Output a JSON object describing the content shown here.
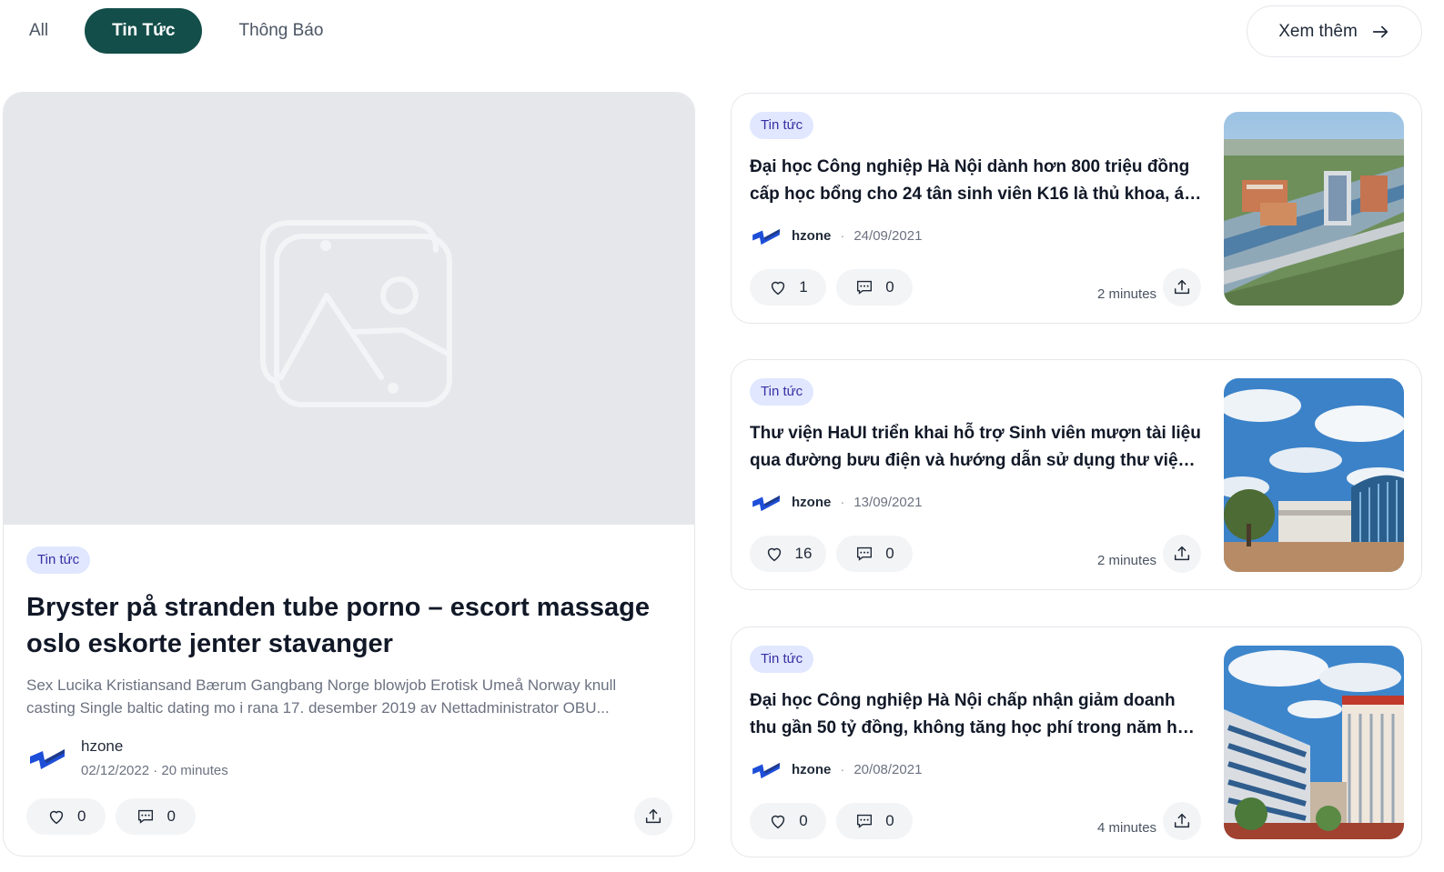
{
  "tabs": [
    {
      "label": "All"
    },
    {
      "label": "Tin Tức"
    },
    {
      "label": "Thông Báo"
    }
  ],
  "more_button": {
    "label": "Xem thêm"
  },
  "featured": {
    "badge": "Tin tức",
    "title": "Bryster på stranden tube porno – escort massage oslo eskorte jenter stavanger",
    "excerpt": "Sex Lucika Kristiansand Bærum Gangbang Norge blowjob Erotisk Umeå Norway knull casting Single baltic dating mo i rana 17. desember 2019 av Nettadministrator OBU...",
    "author": "hzone",
    "meta": "02/12/2022 · 20 minutes",
    "likes": "0",
    "comments": "0"
  },
  "posts": [
    {
      "badge": "Tin tức",
      "title": "Đại học Công nghiệp Hà Nội dành hơn 800 triệu đồng cấp học bổng cho 24 tân sinh viên K16 là thủ khoa, á khoa",
      "author": "hzone",
      "date": "24/09/2021",
      "likes": "1",
      "comments": "0",
      "read_time": "2 minutes"
    },
    {
      "badge": "Tin tức",
      "title": "Thư viện HaUI triển khai hỗ trợ Sinh viên mượn tài liệu qua đường bưu điện và hướng dẫn sử dụng thư viện số",
      "author": "hzone",
      "date": "13/09/2021",
      "likes": "16",
      "comments": "0",
      "read_time": "2 minutes"
    },
    {
      "badge": "Tin tức",
      "title": "Đại học Công nghiệp Hà Nội chấp nhận giảm doanh thu gần 50 tỷ đồng, không tăng học phí trong năm học mới",
      "author": "hzone",
      "date": "20/08/2021",
      "likes": "0",
      "comments": "0",
      "read_time": "4 minutes"
    }
  ],
  "colors": {
    "accent": "#134e4a",
    "badge_bg": "#e0e7ff",
    "badge_text": "#3730a3",
    "logo_blue": "#1d4ed8"
  }
}
